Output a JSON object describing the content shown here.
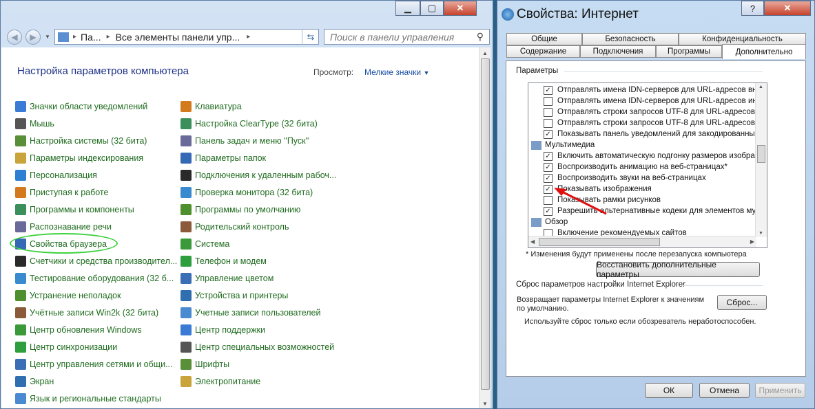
{
  "explorer": {
    "address_parts": [
      "Па...",
      "Все элементы панели упр..."
    ],
    "search_placeholder": "Поиск в панели управления",
    "page_title": "Настройка параметров компьютера",
    "view_label": "Просмотр:",
    "view_value": "Мелкие значки",
    "col1": [
      "Значки области уведомлений",
      "Мышь",
      "Настройка системы (32 бита)",
      "Параметры индексирования",
      "Персонализация",
      "Приступая к работе",
      "Программы и компоненты",
      "Распознавание речи",
      "Свойства браузера",
      "Счетчики и средства производител...",
      "Тестирование оборудования (32 б...",
      "Устранение неполадок",
      "Учётные записи Win2k (32 бита)",
      "Центр обновления Windows",
      "Центр синхронизации",
      "Центр управления сетями и общи...",
      "Экран",
      "Язык и региональные стандарты"
    ],
    "col2": [
      "Клавиатура",
      "Настройка ClearType (32 бита)",
      "Панель задач и меню ''Пуск''",
      "Параметры папок",
      "Подключения к удаленным рабоч...",
      "Проверка монитора (32 бита)",
      "Программы по умолчанию",
      "Родительский контроль",
      "Система",
      "Телефон и модем",
      "Управление цветом",
      "Устройства и принтеры",
      "Учетные записи пользователей",
      "Центр поддержки",
      "Центр специальных возможностей",
      "Шрифты",
      "Электропитание"
    ]
  },
  "dialog": {
    "title": "Свойства: Интернет",
    "tabs_row1": [
      "Общие",
      "Безопасность",
      "Конфиденциальность"
    ],
    "tabs_row2": [
      "Содержание",
      "Подключения",
      "Программы",
      "Дополнительно"
    ],
    "params_label": "Параметры",
    "items": [
      {
        "t": "Отправлять имена IDN-серверов для URL-адресов вне",
        "c": true
      },
      {
        "t": "Отправлять имена IDN-серверов для URL-адресов инт",
        "c": false
      },
      {
        "t": "Отправлять строки запросов UTF-8 для URL-адресов в",
        "c": false
      },
      {
        "t": "Отправлять строки запросов UTF-8 для URL-адресов н",
        "c": false
      },
      {
        "t": "Показывать панель уведомлений для закодированных",
        "c": true
      },
      {
        "t": "Мультимедиа",
        "c": null
      },
      {
        "t": "Включить автоматическую подгонку размеров изобра",
        "c": true
      },
      {
        "t": "Воспроизводить анимацию на веб-страницах*",
        "c": true
      },
      {
        "t": "Воспроизводить звуки на веб-страницах",
        "c": true
      },
      {
        "t": "Показывать изображения",
        "c": true
      },
      {
        "t": "Показывать рамки рисунков",
        "c": false
      },
      {
        "t": "Разрешить альтернативные кодеки для элементов му",
        "c": true
      },
      {
        "t": "Обзор",
        "c": null
      },
      {
        "t": "Включение рекомендуемых сайтов",
        "c": false
      }
    ],
    "restart_note": "* Изменения будут применены после перезапуска компьютера",
    "restore_btn": "Восстановить дополнительные параметры",
    "reset_group": "Сброс параметров настройки Internet Explorer",
    "reset_desc": "Возвращает параметры Internet Explorer к значениям по умолчанию.",
    "reset_btn": "Сброс...",
    "reset_hint": "Используйте сброс только если обозреватель неработоспособен.",
    "ok": "ОК",
    "cancel": "Отмена",
    "apply": "Применить"
  },
  "colors": {
    "link_green": "#1f6b1f",
    "title_blue": "#1e3287",
    "oval": "#3fd13f",
    "arrow": "#e01010"
  }
}
